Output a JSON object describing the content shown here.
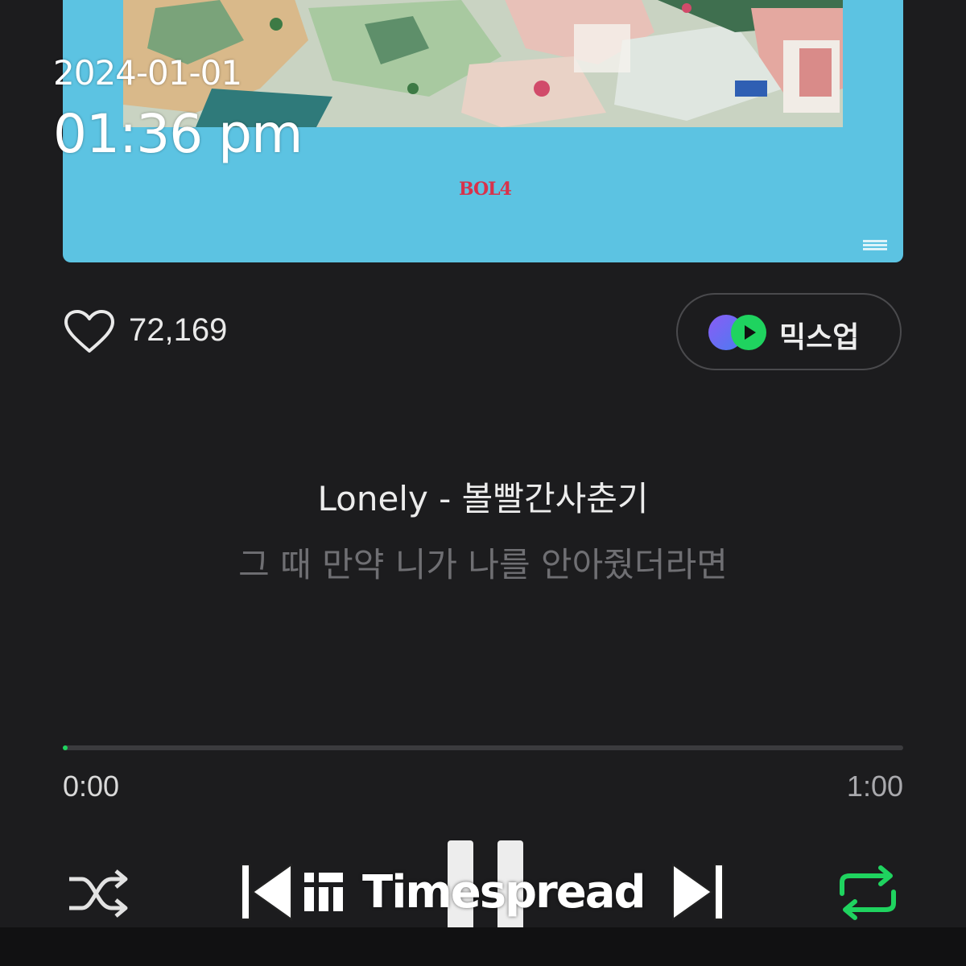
{
  "overlay": {
    "date": "2024-01-01",
    "time": "01:36 pm"
  },
  "album": {
    "artist_logo": "BOL4",
    "background_color": "#5cc3e2"
  },
  "like": {
    "icon": "heart-outline-icon",
    "count": "72,169"
  },
  "mixup": {
    "icon": "mixup-icon",
    "label": "믹스업"
  },
  "lyrics": {
    "title": "Lonely - 볼빨간사춘기",
    "current_line": "그 때 만약 니가 나를 안아줬더라면"
  },
  "playback": {
    "progress_fraction": 0.004,
    "current_time": "0:00",
    "total_time": "1:00",
    "accent_color": "#1fd35f"
  },
  "controls": {
    "shuffle": "shuffle-icon",
    "previous": "skip-previous-icon",
    "pause": "pause-icon",
    "next": "skip-next-icon",
    "repeat": "repeat-icon"
  },
  "watermark": {
    "text": "Timespread"
  }
}
